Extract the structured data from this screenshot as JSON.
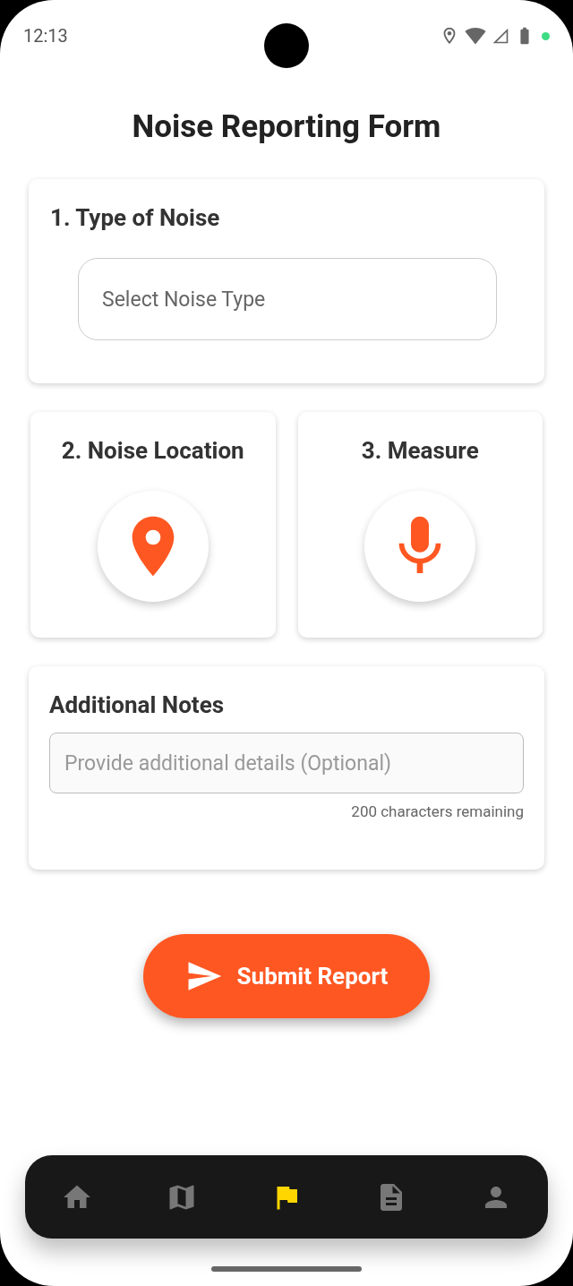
{
  "status_bar": {
    "time": "12:13"
  },
  "title": "Noise Reporting Form",
  "noise_type": {
    "heading": "1. Type of Noise",
    "placeholder": "Select Noise Type"
  },
  "location": {
    "heading": "2. Noise Location"
  },
  "measure": {
    "heading": "3. Measure"
  },
  "notes": {
    "heading": "Additional Notes",
    "placeholder": "Provide additional details (Optional)",
    "counter": "200 characters remaining"
  },
  "submit": {
    "label": "Submit Report"
  },
  "nav": {
    "items": [
      {
        "kind": "home",
        "selected": false
      },
      {
        "kind": "map",
        "selected": false
      },
      {
        "kind": "report",
        "selected": true
      },
      {
        "kind": "document",
        "selected": false
      },
      {
        "kind": "profile",
        "selected": false
      }
    ]
  }
}
